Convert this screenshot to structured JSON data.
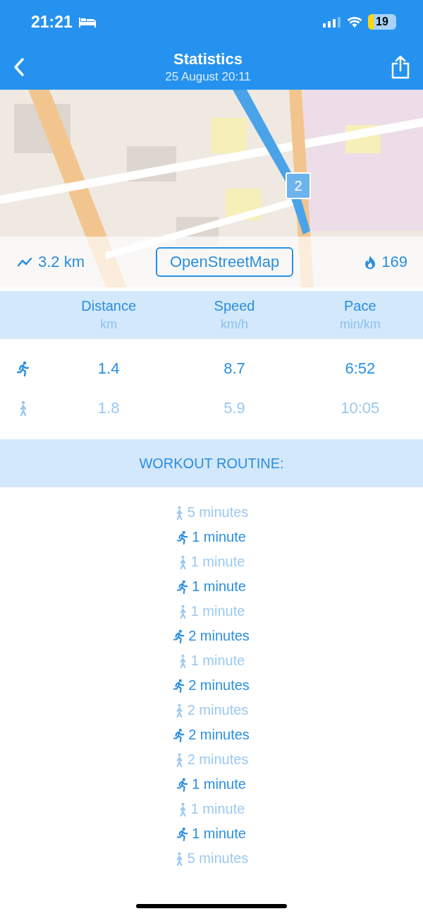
{
  "status_bar": {
    "time": "21:21",
    "battery": "19"
  },
  "nav": {
    "title": "Statistics",
    "subtitle": "25 August 20:11"
  },
  "map": {
    "kind": "picture",
    "pin": "2",
    "distance": "3.2 km",
    "source_button": "OpenStreetMap",
    "calories": "169"
  },
  "table": {
    "columns": [
      {
        "label": "Distance",
        "unit": "km"
      },
      {
        "label": "Speed",
        "unit": "km/h"
      },
      {
        "label": "Pace",
        "unit": "min/km"
      }
    ],
    "rows": [
      {
        "kind": "run",
        "cells": [
          "1.4",
          "8.7",
          "6:52"
        ]
      },
      {
        "kind": "walk",
        "cells": [
          "1.8",
          "5.9",
          "10:05"
        ]
      }
    ]
  },
  "routine": {
    "title": "WORKOUT ROUTINE:",
    "steps": [
      {
        "kind": "walk",
        "text": "5 minutes"
      },
      {
        "kind": "run",
        "text": "1 minute"
      },
      {
        "kind": "walk",
        "text": "1 minute"
      },
      {
        "kind": "run",
        "text": "1 minute"
      },
      {
        "kind": "walk",
        "text": "1 minute"
      },
      {
        "kind": "run",
        "text": "2 minutes"
      },
      {
        "kind": "walk",
        "text": "1 minute"
      },
      {
        "kind": "run",
        "text": "2 minutes"
      },
      {
        "kind": "walk",
        "text": "2 minutes"
      },
      {
        "kind": "run",
        "text": "2 minutes"
      },
      {
        "kind": "walk",
        "text": "2 minutes"
      },
      {
        "kind": "run",
        "text": "1 minute"
      },
      {
        "kind": "walk",
        "text": "1 minute"
      },
      {
        "kind": "run",
        "text": "1 minute"
      },
      {
        "kind": "walk",
        "text": "5 minutes"
      }
    ]
  }
}
